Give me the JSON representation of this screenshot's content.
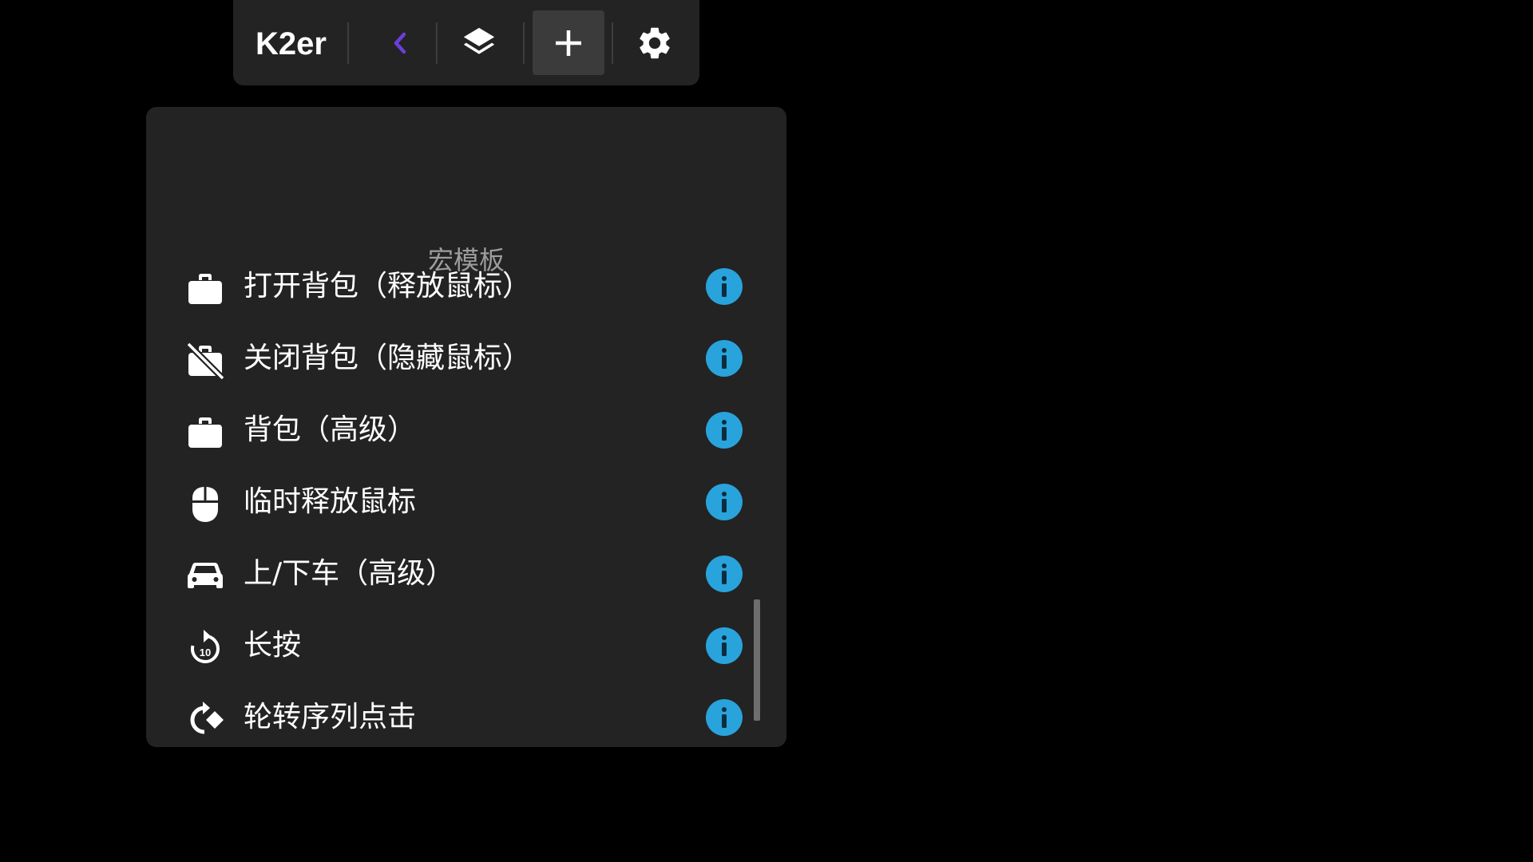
{
  "toolbar": {
    "brand": "K2er",
    "accent_color": "#6a3fd8",
    "buttons": [
      {
        "name": "back",
        "icon": "chevron-left-icon"
      },
      {
        "name": "layers",
        "icon": "layers-icon"
      },
      {
        "name": "add",
        "icon": "plus-icon",
        "active": true
      },
      {
        "name": "settings",
        "icon": "gear-icon"
      }
    ]
  },
  "panel": {
    "title": "宏模板",
    "info_color": "#29a3db",
    "items": [
      {
        "label": "打开背包（释放鼠标）",
        "icon": "briefcase-icon"
      },
      {
        "label": "关闭背包（隐藏鼠标）",
        "icon": "briefcase-off-icon"
      },
      {
        "label": "背包（高级）",
        "icon": "briefcase-icon"
      },
      {
        "label": "临时释放鼠标",
        "icon": "mouse-icon"
      },
      {
        "label": "上/下车（高级）",
        "icon": "car-icon"
      },
      {
        "label": "长按",
        "icon": "replay-10-icon"
      },
      {
        "label": "轮转序列点击",
        "icon": "rotate-sequence-icon"
      }
    ]
  }
}
